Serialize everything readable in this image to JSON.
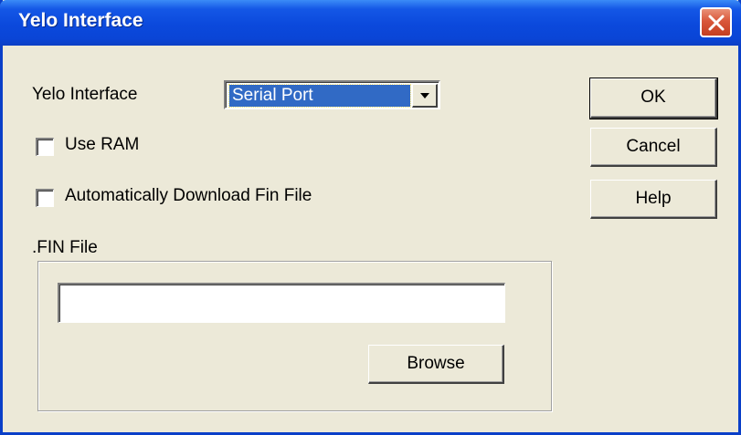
{
  "window": {
    "title": "Yelo Interface"
  },
  "interface_row": {
    "label": "Yelo Interface",
    "selected_value": "Serial Port"
  },
  "options": {
    "use_ram_label": "Use RAM",
    "use_ram_checked": false,
    "auto_download_label": "Automatically Download Fin File",
    "auto_download_checked": false
  },
  "fin_file": {
    "group_label": ".FIN File",
    "path_value": "",
    "browse_label": "Browse"
  },
  "buttons": {
    "ok_label": "OK",
    "cancel_label": "Cancel",
    "help_label": "Help"
  },
  "colors": {
    "title_bar": "#0a45d6",
    "close_button": "#d9573a",
    "selection": "#316ac5",
    "dialog_bg": "#ece9d8"
  },
  "icons": {
    "close": "close-icon",
    "dropdown": "chevron-down-icon"
  }
}
